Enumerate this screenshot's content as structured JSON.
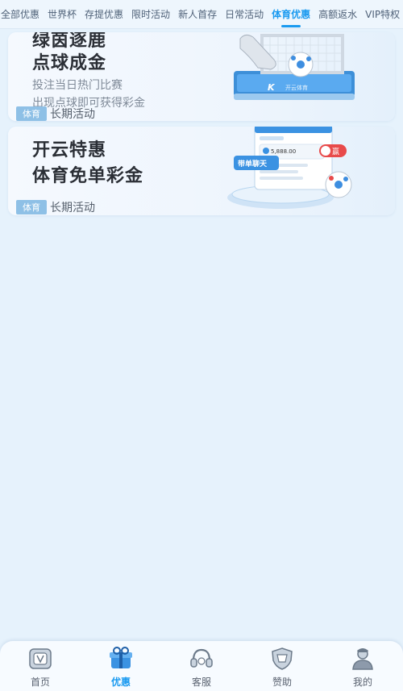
{
  "tabs": [
    {
      "label": "全部优惠",
      "active": false
    },
    {
      "label": "世界杯",
      "active": false
    },
    {
      "label": "存提优惠",
      "active": false
    },
    {
      "label": "限时活动",
      "active": false
    },
    {
      "label": "新人首存",
      "active": false
    },
    {
      "label": "日常活动",
      "active": false
    },
    {
      "label": "体育优惠",
      "active": true
    },
    {
      "label": "高额返水",
      "active": false
    },
    {
      "label": "VIP特权",
      "active": false
    }
  ],
  "promos": [
    {
      "title_lines": [
        "绿茵逐鹿",
        "点球成金"
      ],
      "sub_lines": [
        "投注当日热门比赛",
        "出现点球即可获得彩金"
      ],
      "tag": "体育",
      "tag_text": "长期活动",
      "art_brand": "开云体育",
      "art_logo": "K"
    },
    {
      "title_lines": [
        "开云特惠",
        "体育免单彩金"
      ],
      "tag": "体育",
      "tag_text": "长期活动",
      "art_amount": "5,888.00",
      "art_badge": "赢",
      "art_button": "带单聊天"
    }
  ],
  "bottom_nav": [
    {
      "label": "首页",
      "icon": "home-icon",
      "active": false
    },
    {
      "label": "优惠",
      "icon": "gift-icon",
      "active": true
    },
    {
      "label": "客服",
      "icon": "headset-icon",
      "active": false
    },
    {
      "label": "赞助",
      "icon": "shield-icon",
      "active": false
    },
    {
      "label": "我的",
      "icon": "user-icon",
      "active": false
    }
  ],
  "colors": {
    "accent": "#1a9af0",
    "background": "#e6f2fc",
    "tag": "#8ec0e6"
  }
}
